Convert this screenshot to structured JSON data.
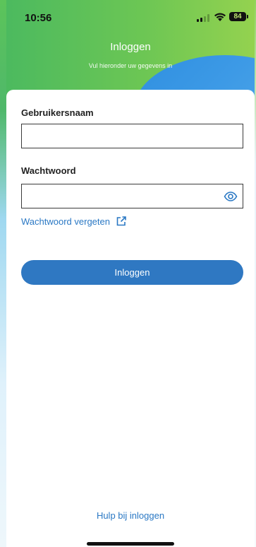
{
  "status_bar": {
    "time": "10:56",
    "battery": "84"
  },
  "header": {
    "title": "Inloggen",
    "subtitle": "Vul hieronder uw gegevens in"
  },
  "form": {
    "username_label": "Gebruikersnaam",
    "username_value": "",
    "password_label": "Wachtwoord",
    "password_value": "",
    "forgot_password_link": "Wachtwoord vergeten",
    "login_button": "Inloggen"
  },
  "footer": {
    "help_link": "Hulp bij inloggen"
  },
  "icons": {
    "signal": "signal-bars-icon",
    "wifi": "wifi-icon",
    "battery": "battery-icon",
    "show_password": "eye-icon",
    "external_link": "external-link-icon"
  },
  "colors": {
    "header_green": "#6cc654",
    "accent_blue": "#2f78c2",
    "link_blue": "#2a78c4"
  }
}
